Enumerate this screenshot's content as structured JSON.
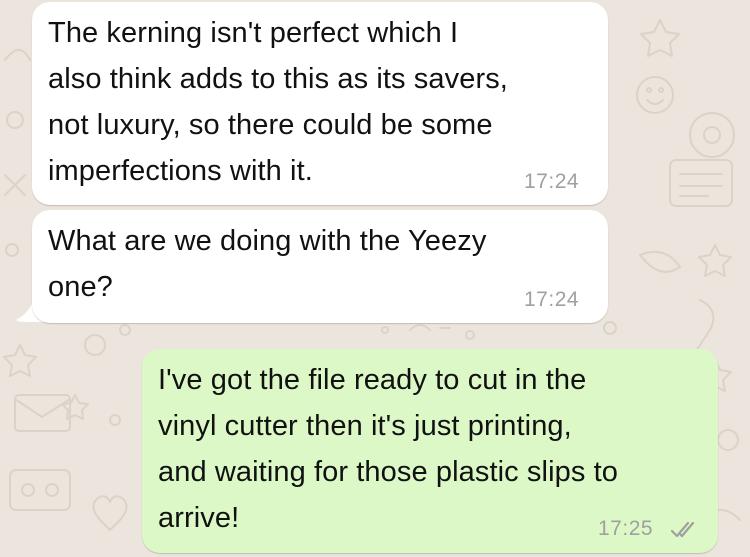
{
  "colors": {
    "wallpaper": "#ece5dd",
    "incoming_bubble": "#ffffff",
    "outgoing_bubble": "#dcf8c6",
    "text": "#111111",
    "timestamp": "#a0a0a0",
    "read_ticks": "#a0a0a0"
  },
  "chat": {
    "messages": [
      {
        "direction": "incoming",
        "lines": [
          "The kerning isn't perfect which I",
          "also think adds to this as its savers,",
          "not luxury, so there could be some",
          "imperfections with it."
        ],
        "time": "17:24"
      },
      {
        "direction": "incoming",
        "lines": [
          "What are we doing with the Yeezy",
          "one?"
        ],
        "time": "17:24"
      },
      {
        "direction": "outgoing",
        "lines": [
          "I've got the file ready to cut in the",
          "vinyl cutter then it's just printing,",
          "and waiting for those plastic slips to",
          "arrive!"
        ],
        "time": "17:25",
        "status_icon": "double-check-read-icon"
      }
    ]
  }
}
